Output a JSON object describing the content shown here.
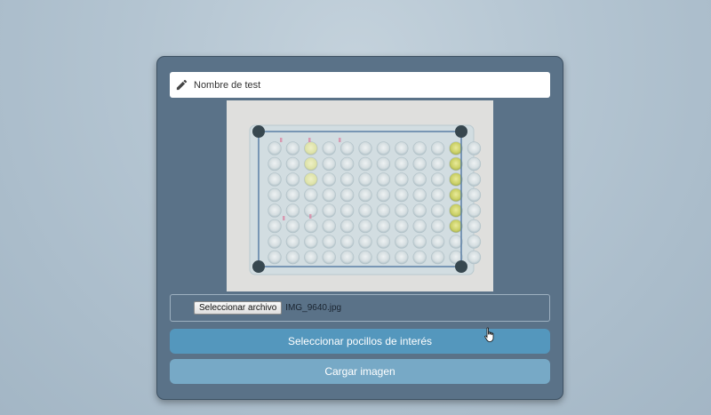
{
  "test_name": {
    "placeholder": "Nombre de test",
    "icon": "pencil-icon"
  },
  "image_preview": {
    "subject": "96-well plate photo",
    "roi_handle_color": "#37474f",
    "roi_border_color": "#5b7fa6"
  },
  "file_input": {
    "button_label": "Seleccionar archivo",
    "file_name": "IMG_9640.jpg"
  },
  "buttons": {
    "select_wells": "Seleccionar pocillos de interés",
    "load_image": "Cargar imagen"
  },
  "colors": {
    "card": "#5a7288",
    "primary_button": "#5497bd",
    "secondary_button": "#77a9c6"
  }
}
